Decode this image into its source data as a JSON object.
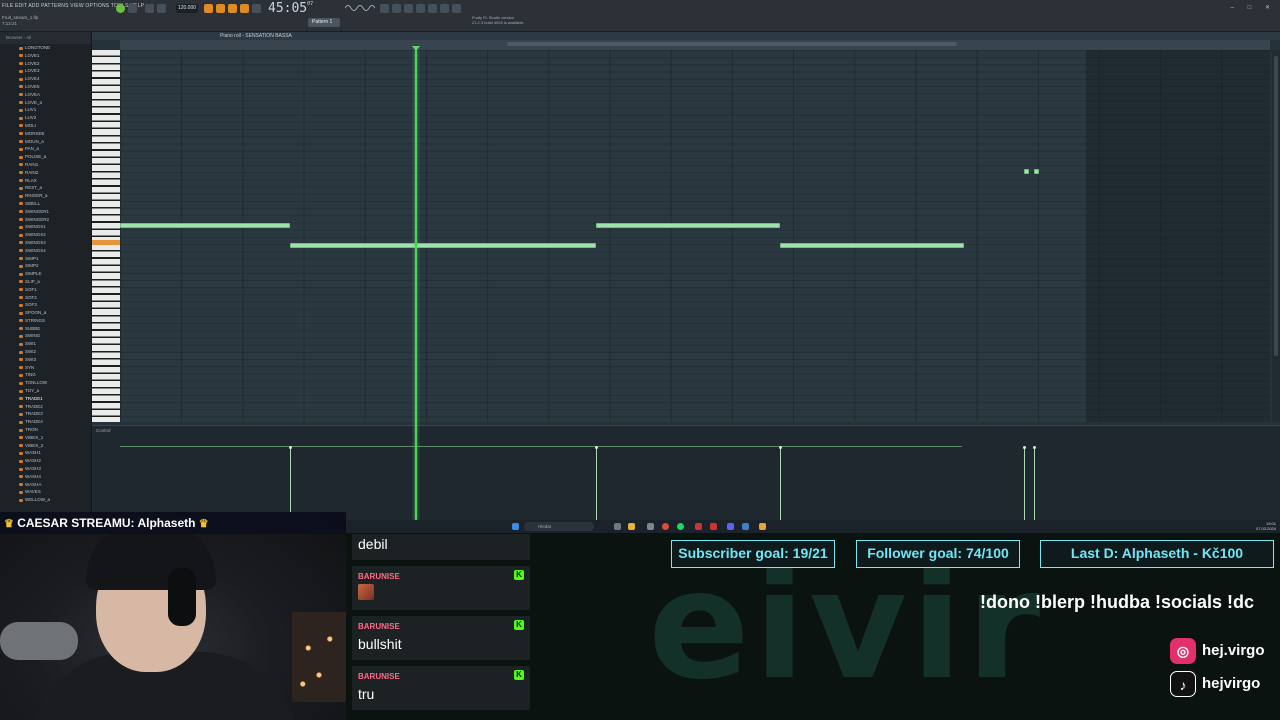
{
  "fl": {
    "menu": "FILE EDIT ADD PATTERNS VIEW OPTIONS TOOLS HELP",
    "project_name": "Fruit_stream_1.flp",
    "project_time": "7:12:21",
    "tempo": "120.000",
    "time_main": "45:05",
    "time_sub": "07",
    "pattern": "Pattern 1",
    "news_line1": "Fruity FL Studio version",
    "news_line2": "21.2.3 build 4004 is available",
    "piano_roll_title": "Piano roll - SENSATION BASSA",
    "control_label": "Control",
    "browser_header": "Browser - All",
    "browser_items": [
      "LONGTONE",
      "LOVE1",
      "LOVE2",
      "LOVE3",
      "LOVE4",
      "LOVE5",
      "LOVEA",
      "LOVE_a",
      "LUV1",
      "LUV2",
      "MOLI",
      "MORSEE",
      "MOUN_a",
      "PAN_a",
      "POLISE_a",
      "RAIN1",
      "RAIN2",
      "RLAX",
      "REST_a",
      "RINGER_a",
      "SIBELL",
      "SWINGER1",
      "SWINGER2",
      "SWINGS1",
      "SWINGS2",
      "SWINGS3",
      "SWINGS4",
      "SIMP1",
      "SIMP2",
      "SIMPLE",
      "SLIP_a",
      "SOF1",
      "SOF2",
      "SOF3",
      "SPOON_a",
      "STRINGS",
      "SUBBE",
      "SWING",
      "SWI1",
      "SWI2",
      "SWI3",
      "SYN",
      "TING",
      "TONLLOW",
      "TOY_a",
      "TRADE1",
      "TRADE2",
      "TRADE3",
      "TRADE4",
      "TRON",
      "VIBES_1",
      "VIBES_2",
      "WASH1",
      "WASH2",
      "WASH3",
      "WASH4",
      "WASHA",
      "WAVES",
      "WELLOW_a"
    ],
    "browser_selected": "TRADE1"
  },
  "taskbar": {
    "search_placeholder": "Hledat",
    "clock_time": "19:01",
    "clock_date": "07.03.2024"
  },
  "stream": {
    "caesar_label": "CAESAR STREAMU: Alphaseth",
    "crown_icon": "♛",
    "background_logo_text": "eivir",
    "goals": {
      "subscriber": "Subscriber goal: 19/21",
      "follower": "Follower goal: 74/100",
      "last_donation": "Last D: Alphaseth - Kč100"
    },
    "commands": "!dono !blerp !hudba !socials !dc",
    "socials": [
      {
        "icon": "instagram-icon",
        "glyph": "◎",
        "color": "#e1306c",
        "handle": "hej.virgo"
      },
      {
        "icon": "tiktok-icon",
        "glyph": "♪",
        "color": "#111111",
        "handle": "hejvirgo"
      }
    ],
    "chat": [
      {
        "user": "",
        "text": "debil",
        "badge": ""
      },
      {
        "user": "BARUNISE",
        "text": "",
        "badge": "K",
        "emote": true
      },
      {
        "user": "BARUNISE",
        "text": "bullshit",
        "badge": "K"
      },
      {
        "user": "BARUNISE",
        "text": "tru",
        "badge": "K"
      }
    ]
  },
  "colors": {
    "note": "#9fe3ac",
    "playhead": "#4fd05a",
    "goal_accent": "#6fe7f5",
    "kick_badge": "#53fc18",
    "chat_user": "#ff6b8a"
  }
}
